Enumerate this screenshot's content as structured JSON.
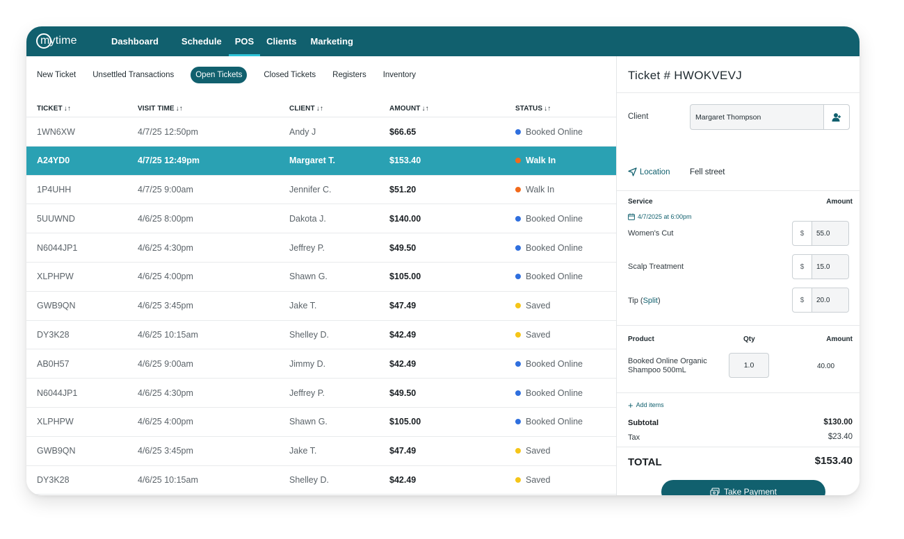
{
  "brand": {
    "name": "mytime"
  },
  "nav": {
    "items": [
      "Dashboard",
      "Schedule",
      "POS",
      "Clients",
      "Marketing"
    ],
    "active": "POS"
  },
  "subnav": {
    "items": [
      "New Ticket",
      "Unsettled Transactions",
      "Open Tickets",
      "Closed Tickets",
      "Registers",
      "Inventory"
    ],
    "active": "Open Tickets"
  },
  "table": {
    "columns": [
      "TICKET",
      "VISIT TIME",
      "CLIENT",
      "AMOUNT",
      "STATUS"
    ],
    "sort_icon": "↓↑",
    "rows": [
      {
        "ticket": "1WN6XW",
        "time": "4/7/25 12:50pm",
        "client": "Andy J",
        "amount": "$66.65",
        "status": "Booked Online",
        "status_color": "#2f6fde"
      },
      {
        "ticket": "A24YD0",
        "time": "4/7/25 12:49pm",
        "client": "Margaret T.",
        "amount": "$153.40",
        "status": "Walk In",
        "status_color": "#f26a1b",
        "selected": true
      },
      {
        "ticket": "1P4UHH",
        "time": "4/7/25 9:00am",
        "client": "Jennifer C.",
        "amount": "$51.20",
        "status": "Walk In",
        "status_color": "#f26a1b"
      },
      {
        "ticket": "5UUWND",
        "time": "4/6/25 8:00pm",
        "client": "Dakota J.",
        "amount": "$140.00",
        "status": "Booked Online",
        "status_color": "#2f6fde"
      },
      {
        "ticket": "N6044JP1",
        "time": "4/6/25 4:30pm",
        "client": "Jeffrey P.",
        "amount": "$49.50",
        "status": "Booked Online",
        "status_color": "#2f6fde"
      },
      {
        "ticket": "XLPHPW",
        "time": "4/6/25 4:00pm",
        "client": "Shawn G.",
        "amount": "$105.00",
        "status": "Booked Online",
        "status_color": "#2f6fde"
      },
      {
        "ticket": "GWB9QN",
        "time": "4/6/25 3:45pm",
        "client": "Jake T.",
        "amount": "$47.49",
        "status": "Saved",
        "status_color": "#f5c518"
      },
      {
        "ticket": "DY3K28",
        "time": "4/6/25 10:15am",
        "client": "Shelley D.",
        "amount": "$42.49",
        "status": "Saved",
        "status_color": "#f5c518"
      },
      {
        "ticket": "AB0H57",
        "time": "4/6/25 9:00am",
        "client": "Jimmy D.",
        "amount": "$42.49",
        "status": "Booked Online",
        "status_color": "#2f6fde"
      },
      {
        "ticket": "N6044JP1",
        "time": "4/6/25 4:30pm",
        "client": "Jeffrey P.",
        "amount": "$49.50",
        "status": "Booked Online",
        "status_color": "#2f6fde"
      },
      {
        "ticket": "XLPHPW",
        "time": "4/6/25 4:00pm",
        "client": "Shawn G.",
        "amount": "$105.00",
        "status": "Booked Online",
        "status_color": "#2f6fde"
      },
      {
        "ticket": "GWB9QN",
        "time": "4/6/25 3:45pm",
        "client": "Jake T.",
        "amount": "$47.49",
        "status": "Saved",
        "status_color": "#f5c518"
      },
      {
        "ticket": "DY3K28",
        "time": "4/6/25 10:15am",
        "client": "Shelley D.",
        "amount": "$42.49",
        "status": "Saved",
        "status_color": "#f5c518"
      }
    ]
  },
  "ticket": {
    "title": "Ticket # HWOKVEVJ",
    "client_label": "Client",
    "client_value": "Margaret Thompson",
    "location_label": "Location",
    "location_value": "Fell street",
    "service_header": "Service",
    "amount_header": "Amount",
    "appointment_date": "4/7/2025 at 6:00pm",
    "currency": "$",
    "services": [
      {
        "name": "Women's Cut",
        "amount": "55.0"
      },
      {
        "name": "Scalp Treatment",
        "amount": "15.0"
      }
    ],
    "tip": {
      "label": "Tip (",
      "link": "Split",
      "close": ")",
      "amount": "20.0"
    },
    "product_header": "Product",
    "qty_header": "Qty",
    "product": {
      "name": "Booked Online Organic Shampoo 500mL",
      "qty": "1.0",
      "amount": "40.00"
    },
    "add_items": "Add items",
    "subtotal_label": "Subtotal",
    "subtotal_value": "$130.00",
    "tax_label": "Tax",
    "tax_value": "$23.40",
    "total_label": "TOTAL",
    "total_value": "$153.40",
    "pay_button": "Take Payment"
  },
  "colors": {
    "brand_teal": "#11606e",
    "selected_row": "#2aa1b3",
    "booked_online": "#2f6fde",
    "walk_in": "#f26a1b",
    "saved": "#f5c518"
  },
  "icons": [
    "logo-icon",
    "sort-icon",
    "add-client-icon",
    "location-pin-icon",
    "calendar-icon",
    "plus-icon",
    "payment-icon"
  ]
}
